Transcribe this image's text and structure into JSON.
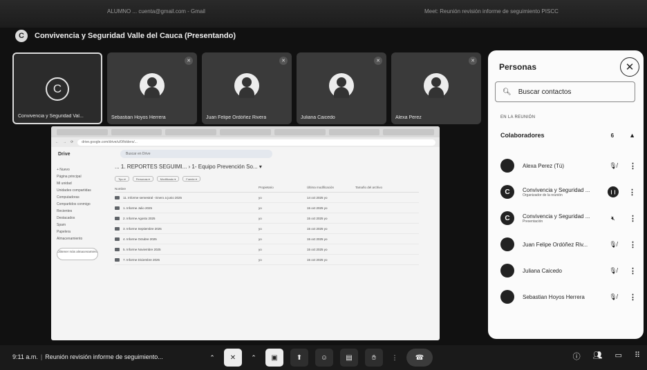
{
  "window": {
    "top_left_faint": "ALUMNO ... cuenta@gmail.com - Gmail",
    "top_right_faint": "Meet: Reunión revisión informe de seguimiento PISCC"
  },
  "presenting": {
    "icon_letter": "C",
    "text": "Convivencia y Seguridad Valle del Cauca (Presentando)"
  },
  "tiles": [
    {
      "name": "Convivencia y Seguridad Val...",
      "letter": "C"
    },
    {
      "name": "Sebastian Hoyos Herrera"
    },
    {
      "name": "Juan Felipe Ordóñez Rivera"
    },
    {
      "name": "Juliana Caicedo"
    },
    {
      "name": "Alexa Perez"
    }
  ],
  "shared_screen": {
    "url": "drive.google.com/drive/u/0/folders/...",
    "drive_logo": "Drive",
    "drive_search": "Buscar en Drive",
    "breadcrumb": "... 1. REPORTES SEGUIMI... › 1- Equipo Prevención So... ▾",
    "chips": [
      "Tipo ▾",
      "Personas ▾",
      "Modificado ▾",
      "Fuente ▾"
    ],
    "sidebar": [
      "+ Nuevo",
      "Página principal",
      "Mi unidad",
      "Unidades compartidas",
      "Computadoras",
      "Compartidos conmigo",
      "Recientes",
      "Destacados",
      "Spam",
      "Papelera",
      "Almacenamiento"
    ],
    "sidebar_button": "Obtener más almacenamiento",
    "columns": [
      "Nombre",
      "Propietario",
      "Última modificación",
      "Tamaño del archivo"
    ],
    "rows": [
      {
        "name": "11. Informe semestral - Enero a junio 2025",
        "owner": "yo",
        "modified": "14 oct 2025 yo"
      },
      {
        "name": "1. Informe Julio 2025",
        "owner": "yo",
        "modified": "15 oct 2025 yo"
      },
      {
        "name": "2. Informe Agosto 2025",
        "owner": "yo",
        "modified": "15 oct 2025 yo"
      },
      {
        "name": "3. Informe Septiembre 2025",
        "owner": "yo",
        "modified": "15 oct 2025 yo"
      },
      {
        "name": "4. Informe Octubre 2025",
        "owner": "yo",
        "modified": "15 oct 2025 yo"
      },
      {
        "name": "5. Informe Noviembre 2025",
        "owner": "yo",
        "modified": "15 oct 2025 yo"
      },
      {
        "name": "7. Informe Diciembre 2025",
        "owner": "yo",
        "modified": "15 oct 2025 yo"
      }
    ]
  },
  "people_panel": {
    "title": "Personas",
    "search_placeholder": "Buscar contactos",
    "section": "EN LA REUNIÓN",
    "group": "Colaboradores",
    "group_count": "6",
    "people": [
      {
        "name": "Alexa Perez (Tú)",
        "sub": "",
        "mic": "muted"
      },
      {
        "name": "Convivencia y Seguridad ...",
        "sub": "Organizador de la reunión",
        "mic": "active",
        "letter": "C"
      },
      {
        "name": "Convivencia y Seguridad ...",
        "sub": "Presentación",
        "mic": "muted",
        "letter": "C"
      },
      {
        "name": "Juan Felipe Ordóñez Riv...",
        "sub": "",
        "mic": "muted"
      },
      {
        "name": "Juliana Caicedo",
        "sub": "",
        "mic": "muted"
      },
      {
        "name": "Sebastian Hoyos Herrera",
        "sub": "",
        "mic": "muted"
      }
    ]
  },
  "bottom_bar": {
    "time": "9:11 a.m.",
    "meeting_title": "Reunión revisión informe de seguimiento..."
  }
}
